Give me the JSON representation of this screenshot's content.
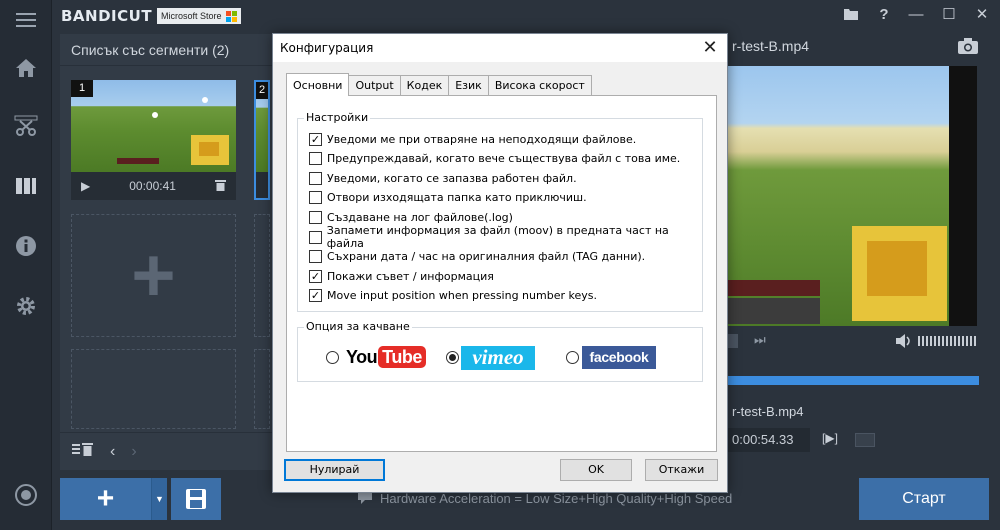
{
  "app": {
    "logo": "BANDICUT",
    "store_badge": "Microsoft Store"
  },
  "window_controls": {
    "folder": "folder-icon",
    "help": "?",
    "minimize": "—",
    "maximize": "☐",
    "close": "✕"
  },
  "sidebar": [
    {
      "name": "menu-icon"
    },
    {
      "name": "home-icon"
    },
    {
      "name": "cut-icon"
    },
    {
      "name": "join-icon"
    },
    {
      "name": "info-icon"
    },
    {
      "name": "settings-icon"
    },
    {
      "name": "record-icon"
    }
  ],
  "segments": {
    "title": "Списък със сегменти (2)",
    "items": [
      {
        "num": "1",
        "time": "00:00:41"
      },
      {
        "num": "2"
      }
    ]
  },
  "bottom": {
    "add_label": "+",
    "hw_text": "Hardware Acceleration = Low Size+High Quality+High Speed",
    "start_label": "Старт"
  },
  "preview": {
    "title": "r-test-B.mp4",
    "file2": "r-test-B.mp4",
    "time2": "0:00:54.33"
  },
  "dialog": {
    "title": "Конфигурация",
    "tabs": [
      "Основни",
      "Output",
      "Кодек",
      "Език",
      "Висока скорост"
    ],
    "settings_label": "Настройки",
    "options": [
      {
        "label": "Уведоми ме при отваряне на неподходящи файлове.",
        "checked": true
      },
      {
        "label": "Предупреждавай, когато вече съществува файл с това име.",
        "checked": false
      },
      {
        "label": "Уведоми, когато се запазва работен файл.",
        "checked": false
      },
      {
        "label": "Отвори изходящата папка като приключиш.",
        "checked": false
      },
      {
        "label": "Създаване на лог файлове(.log)",
        "checked": false
      },
      {
        "label": "Запамети информация за файл (moov) в предната част на файла",
        "checked": false
      },
      {
        "label": "Съхрани дата / час на оригиналния файл (TAG данни).",
        "checked": false
      },
      {
        "label": "Покажи съвет / информация",
        "checked": true
      },
      {
        "label": "Move input position when pressing number keys.",
        "checked": true
      }
    ],
    "upload_label": "Опция за качване",
    "upload": {
      "selected": "vimeo",
      "youtube_you": "You",
      "youtube_tube": "Tube",
      "vimeo": "vimeo",
      "facebook": "facebook"
    },
    "buttons": {
      "reset": "Нулирай",
      "ok": "OK",
      "cancel": "Откажи"
    }
  }
}
